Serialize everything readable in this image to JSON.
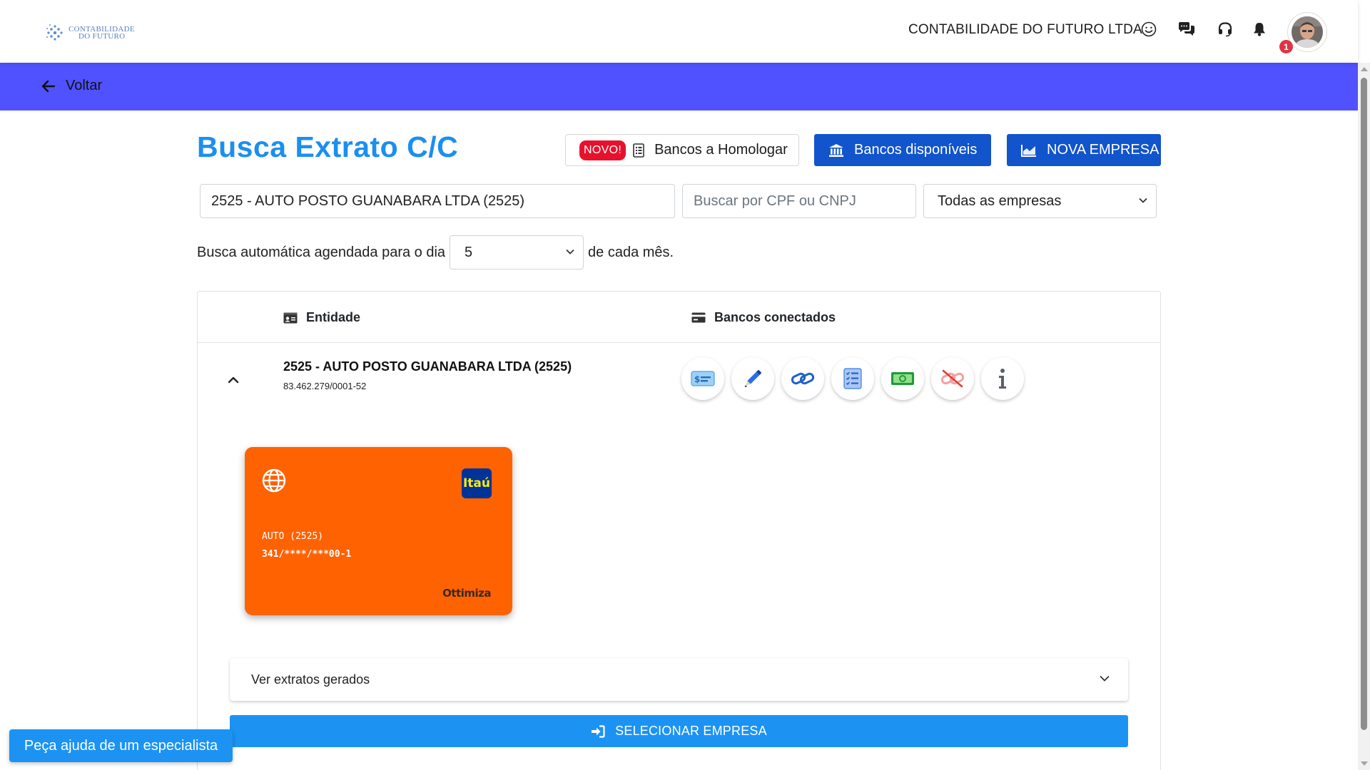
{
  "header": {
    "logo_line1": "CONTABILIDADE",
    "logo_line2": "DO FUTURO",
    "company_name": "CONTABILIDADE DO FUTURO LTDA",
    "notification_count": "1",
    "icons": [
      "smile-icon",
      "chat-icon",
      "headset-icon",
      "bell-icon",
      "avatar"
    ]
  },
  "nav": {
    "back_label": "Voltar"
  },
  "page": {
    "title": "Busca Extrato C/C",
    "homologar": {
      "badge": "NOVO!",
      "label": "Bancos a Homologar"
    },
    "bancos_label": "Bancos disponíveis",
    "nova_empresa_label": "NOVA EMPRESA"
  },
  "filters": {
    "company_value": "2525 - AUTO POSTO GUANABARA LTDA (2525)",
    "search_placeholder": "Buscar por CPF ou CNPJ",
    "companies_select": "Todas as empresas"
  },
  "schedule": {
    "prefix": "Busca automática agendada para o dia",
    "day": "5",
    "suffix": "de cada mês."
  },
  "table": {
    "col_entity": "Entidade",
    "col_banks": "Bancos conectados",
    "entity_name": "2525 - AUTO POSTO GUANABARA LTDA (2525)",
    "entity_cnpj": "83.462.279/0001-52",
    "actions": [
      "statement-icon",
      "edit-icon",
      "link-icon",
      "checklist-icon",
      "money-icon",
      "unlink-icon",
      "info-icon"
    ]
  },
  "bank_card": {
    "bank_logo": "Itaú",
    "holder": "AUTO (2525)",
    "account": "341/****/***00-1",
    "brand": "Ottimiza",
    "color": "#ff6200"
  },
  "extratos_label": "Ver extratos gerados",
  "select_company_label": "SELECIONAR EMPRESA",
  "help_label": "Peça ajuda de um especialista",
  "colors": {
    "accent_bar": "#5052ff",
    "title_blue": "#1b8ff0",
    "primary_dark": "#1154cc",
    "primary_light": "#1c93f3",
    "novo_red": "#e8112d"
  }
}
